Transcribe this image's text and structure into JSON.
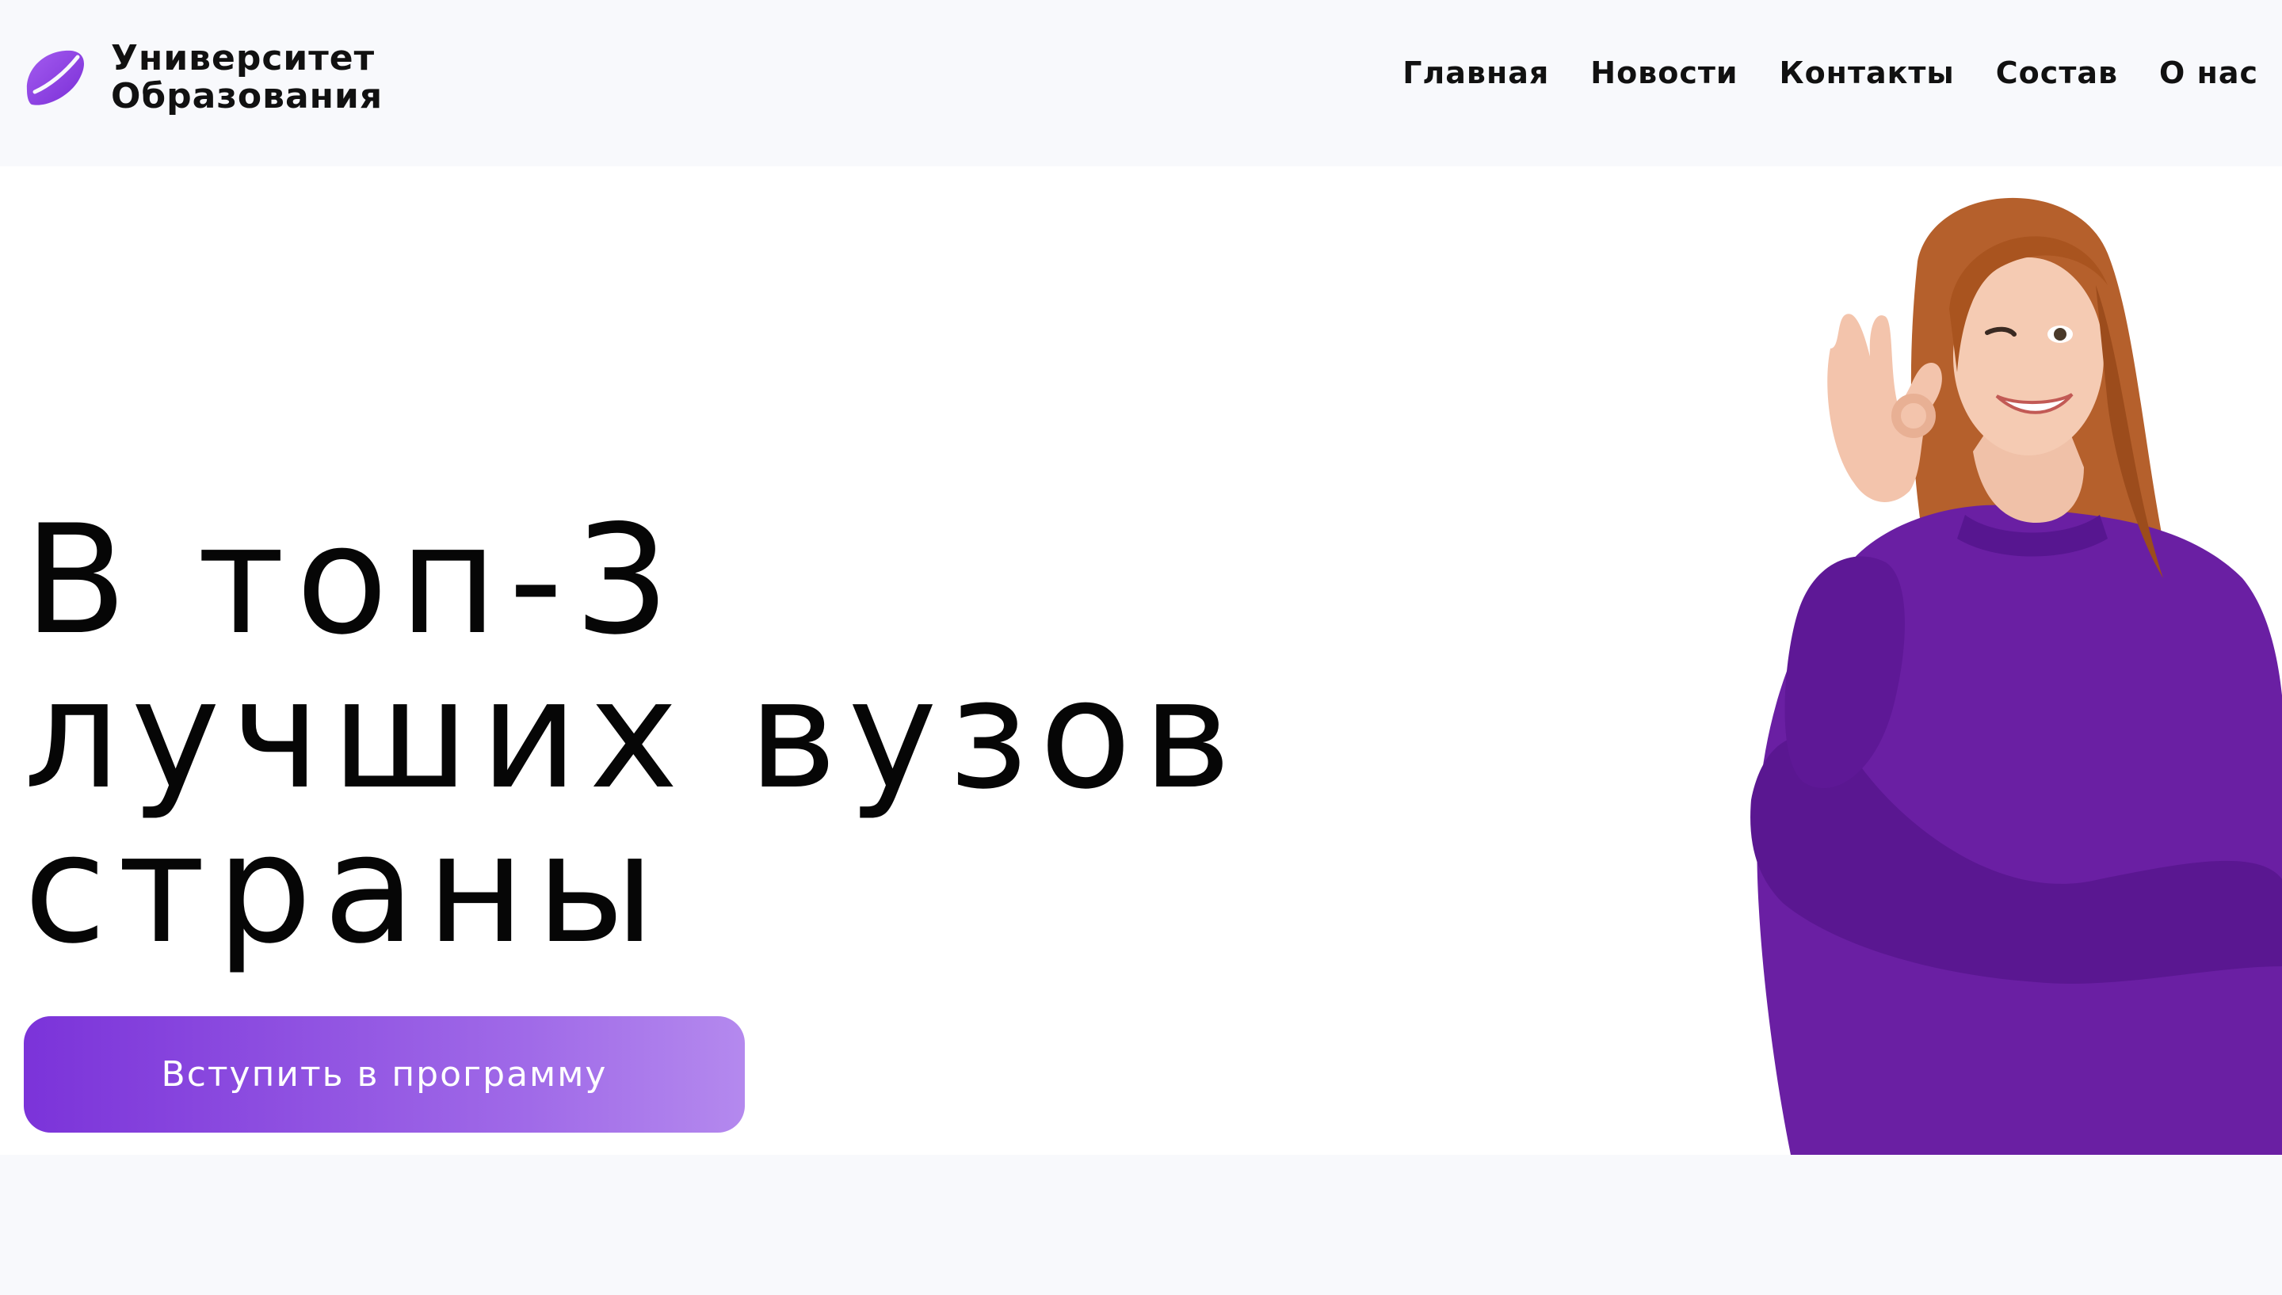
{
  "brand": {
    "line1": "Университет",
    "line2": "Образования",
    "accent": "#8b3fe0"
  },
  "nav": {
    "items": [
      {
        "label": "Главная"
      },
      {
        "label": "Новости"
      },
      {
        "label": "Контакты"
      },
      {
        "label": "Состав"
      },
      {
        "label": "О нас"
      }
    ]
  },
  "hero": {
    "headline": [
      "В топ-3",
      "лучших вузов",
      "страны"
    ],
    "cta_label": "Вступить в программу",
    "cta_gradient": [
      "#7b33d9",
      "#b489ee"
    ],
    "photo": {
      "sweater_color": "#6a1fa3",
      "hair_color": "#b5602c"
    }
  },
  "colors": {
    "page_bg": "#f8f9fc",
    "hero_bg": "#ffffff",
    "text": "#0a0a0a"
  }
}
